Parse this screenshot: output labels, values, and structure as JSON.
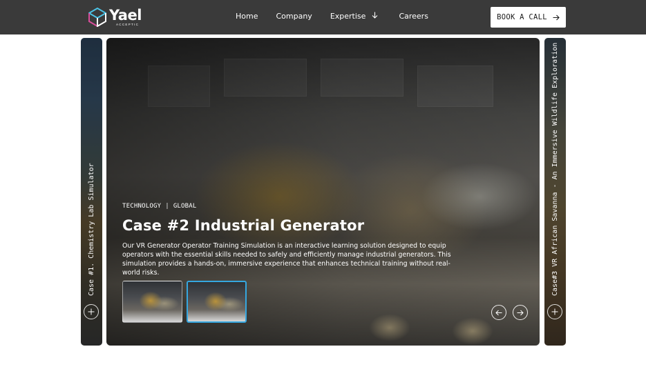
{
  "header": {
    "logo": {
      "word": "Yael",
      "subtitle": "ACCEPTIC"
    },
    "nav": [
      {
        "label": "Home"
      },
      {
        "label": "Company"
      },
      {
        "label": "Expertise",
        "icon": "arrow-down-icon"
      },
      {
        "label": "Careers"
      }
    ],
    "cta": {
      "label": "BOOK A CALL",
      "icon": "arrow-right-icon"
    }
  },
  "carousel": {
    "left_panel": {
      "label": "Case #1. Chemistry Lab Simulator",
      "icon": "plus-icon"
    },
    "right_panel": {
      "label": "Case#3 VR African Savanna - An Immersive Wildlife Exploration",
      "icon": "plus-icon"
    },
    "active_slide": {
      "tags": [
        "TECHNOLOGY",
        "GLOBAL"
      ],
      "tag_separator": "|",
      "title": "Case #2 Industrial Generator",
      "description": "Our VR Generator Operator Training Simulation is an interactive learning solution designed to equip operators with the essential skills needed to safely and efficiently manage industrial generators. This simulation provides a hands-on, immersive experience that enhances technical training without real-world risks.",
      "thumbnails": [
        {
          "selected": false
        },
        {
          "selected": true
        }
      ],
      "controls": {
        "prev_icon": "arrow-left-icon",
        "next_icon": "arrow-right-icon"
      }
    }
  },
  "colors": {
    "header_bg": "#3a3a3a",
    "accent_thumb_border": "#35a7e0",
    "logo_cyan": "#4cc3e6",
    "logo_pink": "#d94c9a"
  }
}
